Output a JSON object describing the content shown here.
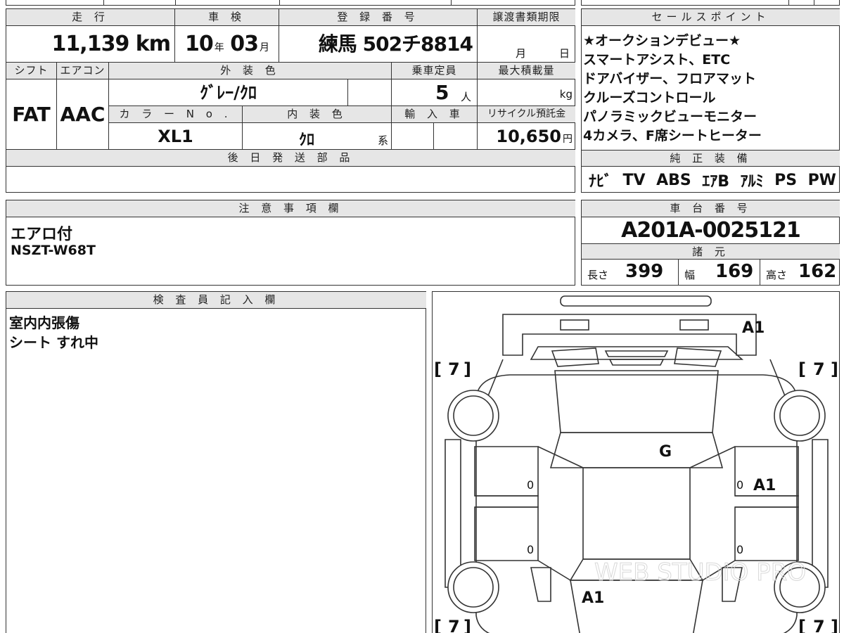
{
  "top": {
    "odometer_label": "走 行",
    "odometer_value": "11,139",
    "odometer_unit": "km",
    "inspection_label": "車 検",
    "inspection_year": "10",
    "inspection_year_unit": "年",
    "inspection_month": "03",
    "inspection_month_unit": "月",
    "reg_label": "登 録 番 号",
    "reg_value": "練馬 502チ8814",
    "transfer_label": "譲渡書類期限",
    "transfer_month_unit": "月",
    "transfer_day_unit": "日"
  },
  "row2": {
    "shift_label": "シフト",
    "ac_label": "エアコン",
    "exterior_label": "外 装 色",
    "capacity_label": "乗車定員",
    "maxload_label": "最大積載量",
    "shift_value": "FAT",
    "ac_value": "AAC",
    "exterior_value": "ｸﾞﾚｰ/ｸﾛ",
    "capacity_value": "5",
    "capacity_unit": "人",
    "maxload_unit": "kg",
    "color_no_label": "カ ラ ー N o .",
    "interior_label": "内 装 色",
    "import_label": "輸 入 車",
    "recycle_label": "リサイクル預託金",
    "color_no_value": "XL1",
    "interior_value": "ｸﾛ",
    "interior_suffix": "系",
    "recycle_value": "10,650",
    "recycle_unit": "円"
  },
  "parts": {
    "label": "後 日 発 送 部 品"
  },
  "sales": {
    "label": "セールスポイント",
    "lines": [
      "★オークションデビュー★",
      "スマートアシスト、ETC",
      "ドアバイザー、フロアマット",
      "クルーズコントロール",
      "パノラミックビューモニター",
      "4カメラ、F席シートヒーター"
    ]
  },
  "equipment": {
    "label": "純 正 装 備",
    "items": [
      "ﾅﾋﾞ",
      "TV",
      "ABS",
      "ｴｱB",
      "ｱﾙﾐ",
      "PS",
      "PW"
    ]
  },
  "notes": {
    "label": "注 意 事 項 欄",
    "lines": [
      "エアロ付",
      "NSZT-W68T"
    ]
  },
  "chassis": {
    "label": "車 台 番 号",
    "value": "A201A-0025121",
    "spec_label": "諸 元",
    "length_label": "長さ",
    "length_value": "399",
    "width_label": "幅",
    "width_value": "169",
    "height_label": "高さ",
    "height_value": "162"
  },
  "inspector": {
    "label": "検 査 員 記 入 欄",
    "lines": [
      "室内内張傷",
      "シート すれ中"
    ]
  },
  "diagram": {
    "marks": {
      "rear_right": "A1",
      "roof": "G",
      "right_side": "A1",
      "front": "A1",
      "zero": "0"
    },
    "tires": {
      "top_left": "7",
      "top_right": "7",
      "bottom_left": "7",
      "bottom_right": "7"
    },
    "watermark": "WEB STUDIO PRO"
  }
}
